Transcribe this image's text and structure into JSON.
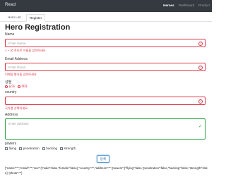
{
  "navbar": {
    "brand": "React",
    "links": [
      {
        "label": "Heroes",
        "active": true
      },
      {
        "label": "Dashboard",
        "active": false
      },
      {
        "label": "Product",
        "active": false
      }
    ]
  },
  "tabs": [
    {
      "label": "Hero List",
      "active": false
    },
    {
      "label": "Register",
      "active": true
    }
  ],
  "page_title": "Hero Registration",
  "form": {
    "name": {
      "label": "Name",
      "placeholder": "Enter Name",
      "error": "1 ~ 10 자리로 이름을 입력하세요."
    },
    "email": {
      "label": "Email Address",
      "placeholder": "Enter Email",
      "error": "이메일 형식을 입력하세요."
    },
    "sex": {
      "label": "성별",
      "options": [
        "남자",
        "여자"
      ]
    },
    "country": {
      "label": "country",
      "error": "국가를 선택하세요."
    },
    "address": {
      "label": "Address",
      "placeholder": "Enter address"
    },
    "powers": {
      "label": "powers",
      "options": [
        "flying",
        "penetration",
        "hacking",
        "strength"
      ]
    },
    "submit_label": "등록"
  },
  "output_json": "{\"name\":\"\",\"email\":\"\",\"sex\":{\"male\":false,\"female\":false},\"country\":\"\",\"address\":\"\",\"powers\":{\"flying\":false,\"penetration\":false,\"hacking\":false,\"strength\":false},\"photo\":\"\"}",
  "colors": {
    "error": "#dc3545",
    "valid": "#28a745",
    "navbar": "#343a40",
    "primary": "#2a6fb0"
  },
  "icons": {
    "error": "exclamation-circle-icon",
    "valid": "checkmark-icon"
  }
}
